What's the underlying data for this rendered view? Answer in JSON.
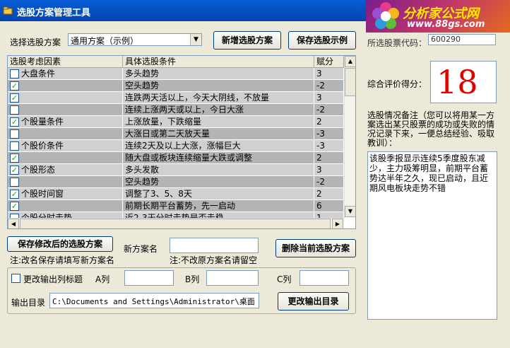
{
  "window": {
    "title": "选股方案管理工具"
  },
  "logo": {
    "brand": "分析家公式网",
    "url": "www.88gs.com"
  },
  "scheme": {
    "label": "选择选股方案",
    "selected": "通用方案（示例）",
    "new_button": "新增选股方案",
    "save_sample_button": "保存选股示例"
  },
  "grid": {
    "headers": [
      "选股考虑因素",
      "具体选股条件",
      "赋分"
    ],
    "rows": [
      {
        "checked": false,
        "factor": "大盘条件",
        "condition": "多头趋势",
        "score": "3"
      },
      {
        "checked": true,
        "factor": "",
        "condition": "空头趋势",
        "score": "-2"
      },
      {
        "checked": true,
        "factor": "",
        "condition": "连跌两天活以上，今天大阴线，不放量",
        "score": "3"
      },
      {
        "checked": false,
        "factor": "",
        "condition": "连续上涨两天或以上，今日大涨",
        "score": "-2"
      },
      {
        "checked": true,
        "factor": "个股量条件",
        "condition": "上涨放量，下跌缩量",
        "score": "2"
      },
      {
        "checked": false,
        "factor": "",
        "condition": "大涨日或第二天放天量",
        "score": "-3"
      },
      {
        "checked": false,
        "factor": "个股价条件",
        "condition": "连续2天及以上大涨，涨幅巨大",
        "score": "-3"
      },
      {
        "checked": true,
        "factor": "",
        "condition": "随大盘或板块连续缩量大跌或调整",
        "score": "2"
      },
      {
        "checked": true,
        "factor": "个股形态",
        "condition": "多头发散",
        "score": "3"
      },
      {
        "checked": false,
        "factor": "",
        "condition": "空头趋势",
        "score": "-2"
      },
      {
        "checked": true,
        "factor": "个股时间窗",
        "condition": "调整了3、5、8天",
        "score": "2"
      },
      {
        "checked": true,
        "factor": "",
        "condition": "前期长期平台蓄势，先一启动",
        "score": "6"
      },
      {
        "checked": false,
        "factor": "个股分时走势",
        "condition": "近2-3天分时走势是否走稳",
        "score": "1"
      }
    ]
  },
  "save": {
    "save_button": "保存修改后的选股方案",
    "save_note": "注:改名保存请填写新方案名",
    "new_name_label": "新方案名",
    "new_name_value": "",
    "new_name_note": "注:不改原方案名请留空",
    "delete_button": "删除当前选股方案"
  },
  "output": {
    "change_titles_label": "更改输出列标题",
    "col_a": "A列",
    "col_b": "B列",
    "col_c": "C列",
    "dir_label": "输出目录",
    "dir_value": "C:\\Documents and Settings\\Administrator\\桌面",
    "change_dir_button": "更改输出目录"
  },
  "right": {
    "code_label": "所选股票代码：",
    "code_value": "600290",
    "score_label": "综合评价得分：",
    "score_value": "18",
    "notes_label": "选股情况备注（您可以将用某一方案选出某只股票的成功或失败的情况记录下来，一便总结经验、吸取教训）：",
    "notes_text": "该股季报显示连续5季度股东减少，主力吸筹明显，前期平台蓄势达半年之久，现已启动，且近期风电板块走势不错"
  }
}
